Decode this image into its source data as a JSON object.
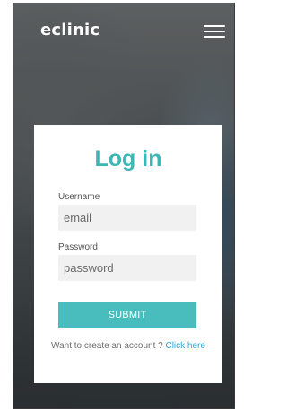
{
  "navbar": {
    "brand": "eclinic",
    "menu_icon": "hamburger-menu-icon"
  },
  "login": {
    "title": "Log in",
    "username_label": "Username",
    "username_placeholder": "email",
    "password_label": "Password",
    "password_placeholder": "password",
    "submit_label": "SUBMIT",
    "signup_text": "Want to create an account ? ",
    "signup_link": "Click here"
  },
  "colors": {
    "accent": "#49bdbd",
    "title": "#3db6b6",
    "link": "#2aa3d8"
  }
}
